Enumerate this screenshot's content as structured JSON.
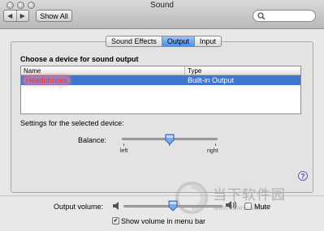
{
  "window": {
    "title": "Sound"
  },
  "toolbar": {
    "back_glyph": "◀",
    "forward_glyph": "▶",
    "show_all_label": "Show All",
    "search": {
      "value": "",
      "icon": "magnifier-icon"
    }
  },
  "tabs": [
    {
      "label": "Sound Effects",
      "active": false
    },
    {
      "label": "Output",
      "active": true
    },
    {
      "label": "Input",
      "active": false
    }
  ],
  "output": {
    "choose_label": "Choose a device for sound output",
    "columns": [
      "Name",
      "Type"
    ],
    "devices": [
      {
        "name": "Headphones",
        "type": "Built-in Output",
        "selected": true
      }
    ],
    "settings_label": "Settings for the selected device:",
    "balance": {
      "label": "Balance:",
      "left_label": "left",
      "right_label": "right",
      "value": 0.5
    },
    "help_glyph": "?"
  },
  "volume": {
    "label": "Output volume:",
    "level": 0.5,
    "mute_label": "Mute",
    "mute_checked": false,
    "show_in_menu_bar_label": "Show volume in menu bar",
    "show_in_menu_bar_checked": true,
    "check_glyph": "✔"
  },
  "watermark": {
    "text": "当下软件园",
    "url": "www.downxia.com"
  },
  "colors": {
    "selection": "#3e76d1",
    "active_tab": "#4d8ee4",
    "highlight": "#ff3333"
  }
}
